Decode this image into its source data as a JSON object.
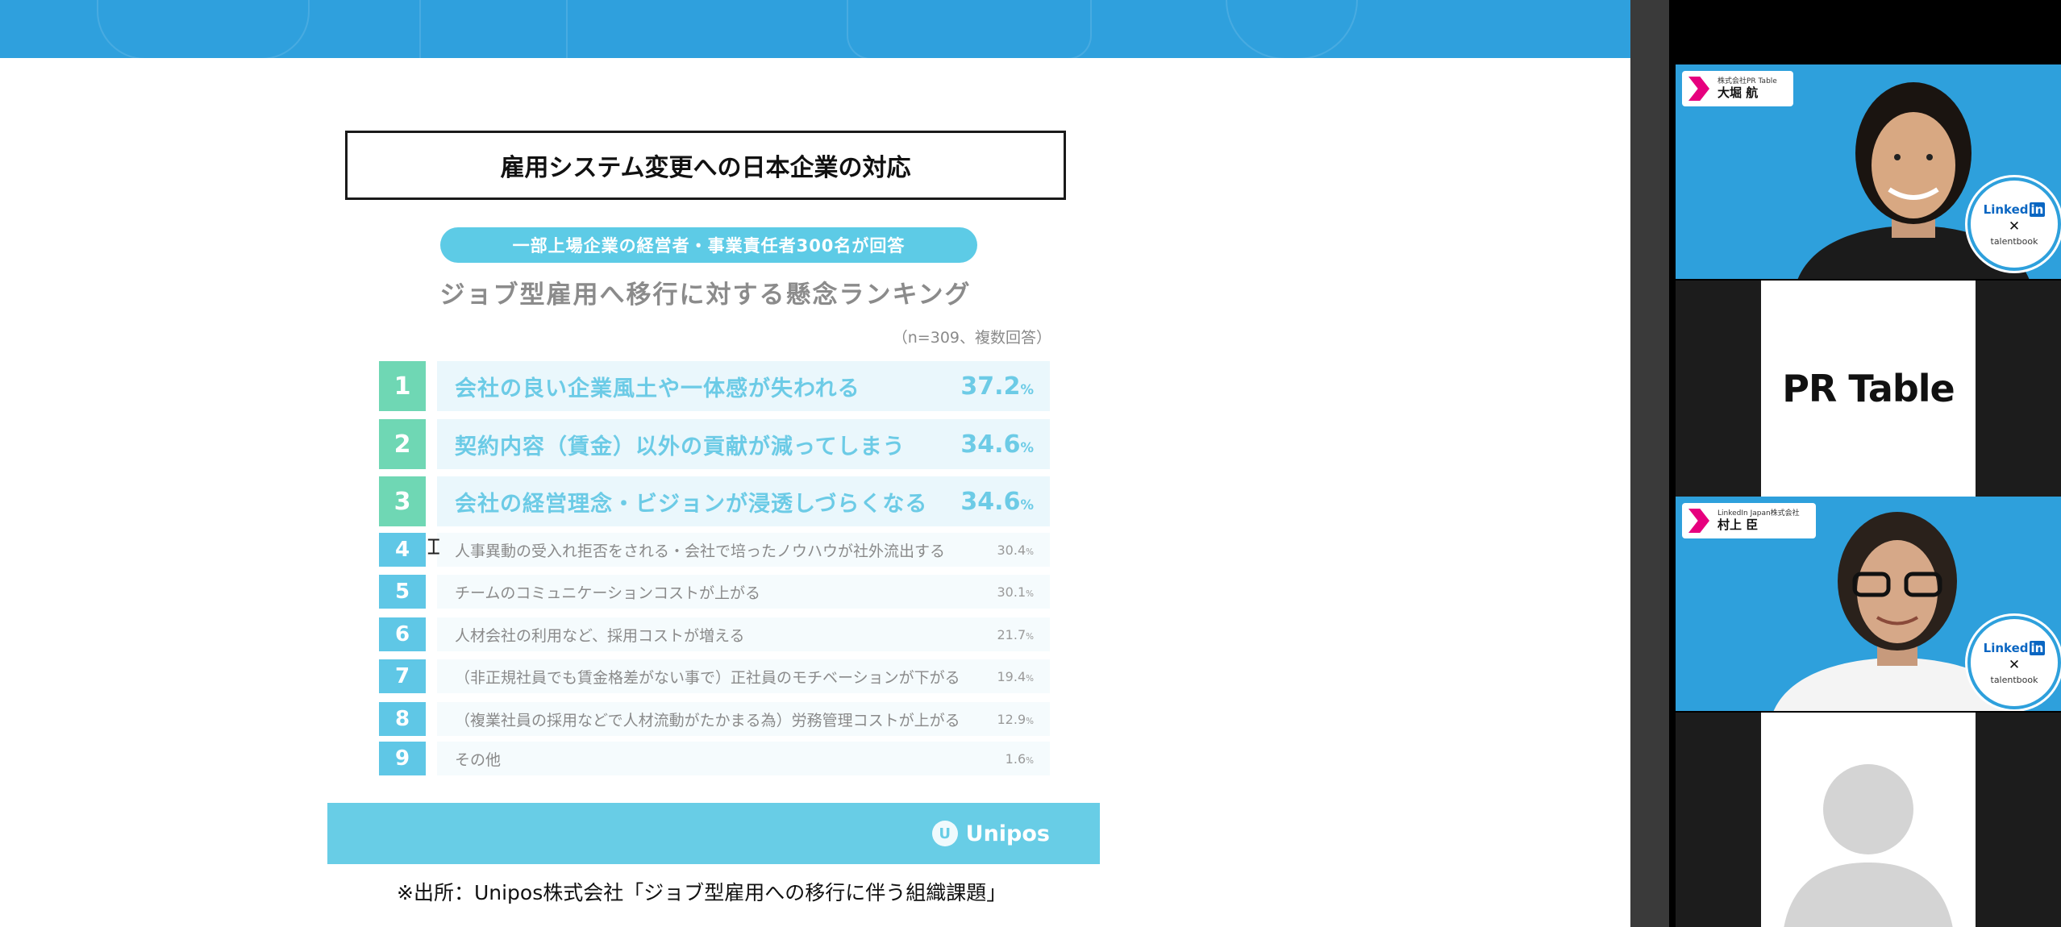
{
  "slide": {
    "title": "雇用システム変更への日本企業の対応",
    "pill": "一部上場企業の経営者・事業責任者300名が回答",
    "subtitle": "ジョブ型雇用へ移行に対する懸念ランキング",
    "note": "（n=309、複数回答）",
    "rankings": [
      {
        "rank": "1",
        "label": "会社の良い企業風土や一体感が失われる",
        "value": "37.2",
        "unit": "%"
      },
      {
        "rank": "2",
        "label": "契約内容（賃金）以外の貢献が減ってしまう",
        "value": "34.6",
        "unit": "%"
      },
      {
        "rank": "3",
        "label": "会社の経営理念・ビジョンが浸透しづらくなる",
        "value": "34.6",
        "unit": "%"
      },
      {
        "rank": "4",
        "label": "人事異動の受入れ拒否をされる・会社で培ったノウハウが社外流出する",
        "value": "30.4",
        "unit": "%"
      },
      {
        "rank": "5",
        "label": "チームのコミュニケーションコストが上がる",
        "value": "30.1",
        "unit": "%"
      },
      {
        "rank": "6",
        "label": "人材会社の利用など、採用コストが増える",
        "value": "21.7",
        "unit": "%"
      },
      {
        "rank": "7",
        "label": "（非正規社員でも賃金格差がない事で）正社員のモチベーションが下がる",
        "value": "19.4",
        "unit": "%"
      },
      {
        "rank": "8",
        "label": "（複業社員の採用などで人材流動がたかまる為）労務管理コストが上がる",
        "value": "12.9",
        "unit": "%"
      },
      {
        "rank": "9",
        "label": "その他",
        "value": "1.6",
        "unit": "%"
      }
    ],
    "footer_logo": "Unipos",
    "source": "※出所：Unipos株式会社「ジョブ型雇用への移行に伴う組織課題」"
  },
  "participants": {
    "tile1": {
      "company": "株式会社PR Table",
      "name": "大堀 航"
    },
    "tile2": {
      "logo": "PR Table"
    },
    "tile3": {
      "company": "LinkedIn Japan株式会社",
      "name": "村上 臣"
    },
    "badge": {
      "linkedin": "Linked",
      "in": "in",
      "x": "✕",
      "talentbook": "talentbook"
    }
  },
  "colors": {
    "banner": "#2fa0dd",
    "pill": "#5dcbe6",
    "top_rank": "#6fd7b4",
    "rank_accent": "#6ccbe6",
    "footer": "#68cde6",
    "brand_pink": "#e6007e",
    "video_bg": "#2ea0dc"
  }
}
